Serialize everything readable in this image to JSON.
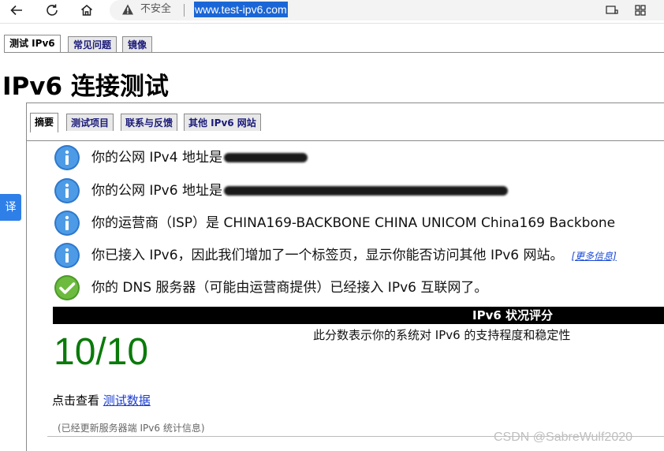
{
  "browser": {
    "insecure_label": "不安全",
    "url": "www.test-ipv6.com"
  },
  "top_tabs": [
    {
      "label": "测试 IPv6"
    },
    {
      "label": "常见问题"
    },
    {
      "label": "镜像"
    }
  ],
  "page_title": "IPv6 连接测试",
  "inner_tabs": [
    {
      "label": "摘要"
    },
    {
      "label": "测试项目"
    },
    {
      "label": "联系与反馈"
    },
    {
      "label": "其他 IPv6 网站"
    }
  ],
  "translate_label": "译",
  "results": [
    {
      "icon": "info-icon",
      "text": "你的公网 IPv4 地址是"
    },
    {
      "icon": "info-icon",
      "text": "你的公网 IPv6 地址是"
    },
    {
      "icon": "info-icon",
      "text": "你的运营商（ISP）是 CHINA169-BACKBONE CHINA UNICOM China169 Backbone"
    },
    {
      "icon": "info-icon",
      "text": "你已接入 IPv6，因此我们增加了一个标签页，显示你能否访问其他 IPv6 网站。",
      "link": "[更多信息]"
    },
    {
      "icon": "check-icon",
      "text": "你的 DNS 服务器（可能由运营商提供）已经接入 IPv6 互联网了。"
    }
  ],
  "score": {
    "heading": "IPv6 状况评分",
    "value": "10/10",
    "description": "此分数表示你的系统对 IPv6 的支持程度和稳定性"
  },
  "click_prefix": "点击查看",
  "click_link": "测试数据",
  "footnote": "(已经更新服务器端 IPv6 统计信息)",
  "watermark": "CSDN @SabreWulf2020",
  "colors": {
    "info_blue": "#3f8fdc",
    "check_green": "#5aa832",
    "score_green": "#0a7a0a",
    "link_blue": "#1a3cd0"
  }
}
